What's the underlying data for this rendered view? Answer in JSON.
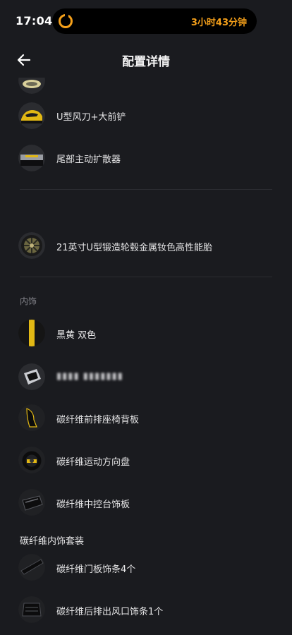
{
  "status": {
    "time": "17:04",
    "timer_text": "3小时43分钟"
  },
  "header": {
    "title": "配置详情",
    "back_icon": "arrow-left-icon"
  },
  "exterior_items": [
    {
      "label": "U型风刀+大前铲"
    },
    {
      "label": "尾部主动扩散器"
    }
  ],
  "wheel_item": {
    "label": "21英寸U型锻造轮毂金属钕色高性能胎"
  },
  "interior": {
    "section_title": "内饰",
    "items": [
      {
        "label": "黑黄 双色"
      },
      {
        "label": "碳纤维前排座椅背板"
      },
      {
        "label": "碳纤维运动方向盘"
      },
      {
        "label": "碳纤维中控台饰板"
      }
    ]
  },
  "carbon_package": {
    "title": "碳纤维内饰套装",
    "items": [
      {
        "label": "碳纤维门板饰条4个"
      },
      {
        "label": "碳纤维后排出风口饰条1个"
      }
    ]
  },
  "colors": {
    "background": "#1a1b1f",
    "accent": "#f5a01a",
    "divider": "#2b2c31",
    "yellow": "#e2b814"
  }
}
